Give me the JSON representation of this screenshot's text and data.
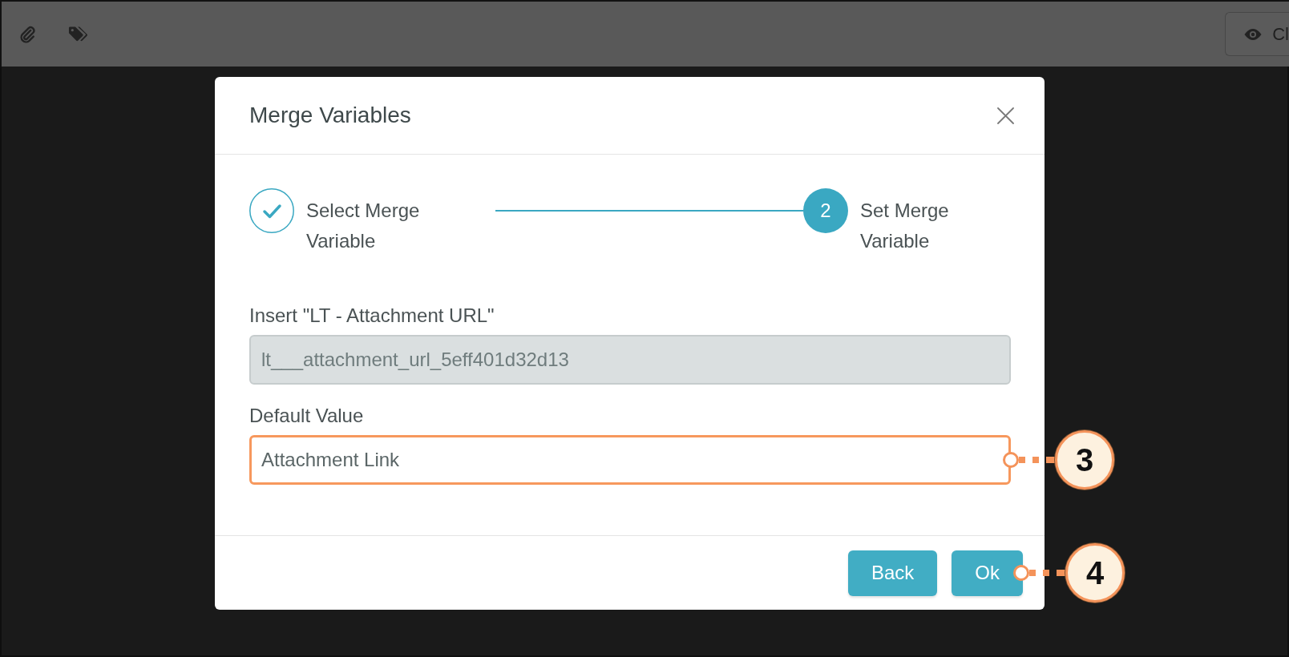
{
  "toolbar": {
    "button": {
      "label": "Cl"
    }
  },
  "dialog": {
    "title": "Merge Variables",
    "steps": [
      {
        "label": "Select Merge Variable",
        "completed": true
      },
      {
        "number": "2",
        "label": "Set Merge Variable",
        "completed": false
      }
    ],
    "fields": [
      {
        "label": "Insert \"LT - Attachment URL\"",
        "value": "lt___attachment_url_5eff401d32d13",
        "readonly": true,
        "highlighted": false
      },
      {
        "label": "Default Value",
        "value": "Attachment Link",
        "readonly": false,
        "highlighted": true,
        "callout": "3"
      }
    ],
    "buttons": [
      {
        "label": "Back"
      },
      {
        "label": "Ok",
        "callout": "4"
      }
    ]
  }
}
